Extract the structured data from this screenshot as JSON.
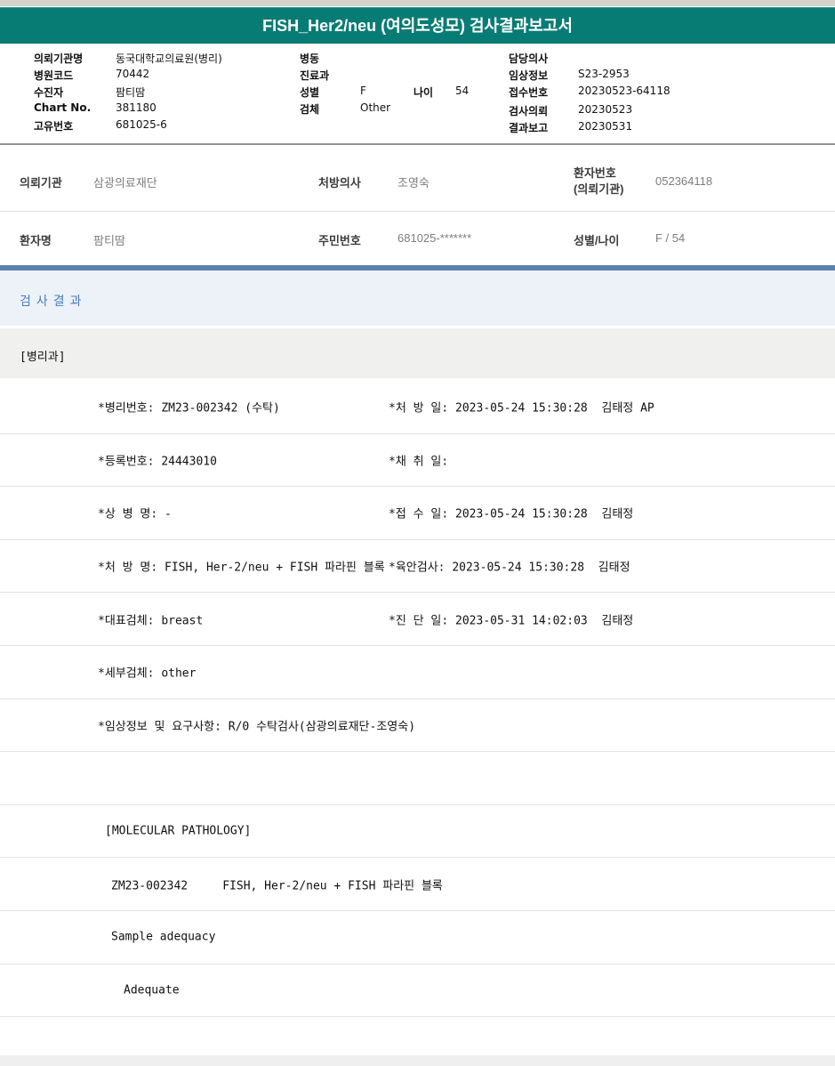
{
  "title": "FISH_Her2/neu (여의도성모) 검사결과보고서",
  "colors": {
    "teal_header": "#077c74",
    "blue_bar": "#5b82ad",
    "section_title_blue": "#4a7db8",
    "result_band_bg": "#edf2f8",
    "dept_band_bg": "#f0f0ee"
  },
  "header": {
    "left": [
      {
        "label": "의뢰기관명",
        "value": "동국대학교의료원(병리)"
      },
      {
        "label": "병원코드",
        "value": "70442"
      },
      {
        "label": "수진자",
        "value": "팜티땀"
      },
      {
        "label": "Chart No.",
        "value": "381180"
      },
      {
        "label": "고유번호",
        "value": "681025-6"
      }
    ],
    "middle": {
      "ward_label": "병동",
      "ward_value": "",
      "dept_label": "진료과",
      "dept_value": "",
      "sex_label": "성별",
      "sex_value": "F",
      "age_label": "나이",
      "age_value": "54",
      "specimen_label": "검체",
      "specimen_value": "Other"
    },
    "right": [
      {
        "label": "담당의사",
        "value": ""
      },
      {
        "label": "임상정보",
        "value": "S23-2953"
      },
      {
        "label": "접수번호",
        "value": "20230523-64118"
      },
      {
        "label": "검사의뢰",
        "value": "20230523"
      },
      {
        "label": "결과보고",
        "value": "20230531"
      }
    ]
  },
  "patient": {
    "row1": [
      {
        "label": "의뢰기관",
        "value": "삼광의료재단"
      },
      {
        "label": "처방의사",
        "value": "조영숙"
      },
      {
        "label": "환자번호\n(의뢰기관)",
        "value": "052364118"
      }
    ],
    "row2": [
      {
        "label": "환자명",
        "value": "팜티땀"
      },
      {
        "label": "주민번호",
        "value": "681025-*******"
      },
      {
        "label": "성별/나이",
        "value": "F / 54"
      }
    ]
  },
  "results": {
    "section_title": "검사결과",
    "department": "[병리과]",
    "rows": [
      {
        "left": "*병리번호: ZM23-002342 (수탁)",
        "right": "*처 방 일: 2023-05-24 15:30:28  김태정 AP"
      },
      {
        "left": "*등록번호: 24443010",
        "right": "*채 취 일:"
      },
      {
        "left": "*상 병 명: -",
        "right": "*접 수 일: 2023-05-24 15:30:28  김태정"
      },
      {
        "left": "*처 방 명: FISH, Her-2/neu + FISH 파라핀 블록",
        "right": "*육안검사: 2023-05-24 15:30:28  김태정"
      },
      {
        "left": "*대표검체: breast",
        "right": "*진 단 일: 2023-05-31 14:02:03  김태정"
      },
      {
        "left": "*세부검체: other",
        "right": ""
      },
      {
        "left": "*임상정보 및 요구사항: R/0 수탁검사(삼광의료재단-조영숙)",
        "right": ""
      },
      {
        "left": "",
        "right": ""
      },
      {
        "left": "[MOLECULAR PATHOLOGY]",
        "right": ""
      },
      {
        "left": "ZM23-002342     FISH, Her-2/neu + FISH 파라핀 블록",
        "right": ""
      },
      {
        "left": "Sample adequacy",
        "right": ""
      },
      {
        "left": "Adequate",
        "right": ""
      },
      {
        "left": "",
        "right": ""
      }
    ]
  }
}
